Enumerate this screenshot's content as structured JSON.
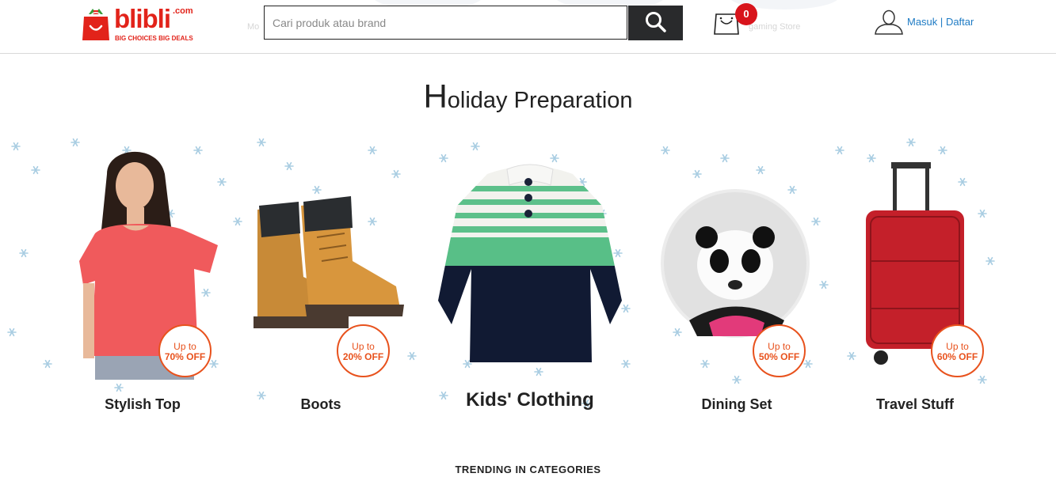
{
  "header": {
    "logo": {
      "word": "blibli",
      "dotcom": ".com",
      "tagline": "BIG CHOICES  BIG DEALS"
    },
    "search": {
      "placeholder": "Cari produk atau brand",
      "value": ""
    },
    "cart": {
      "count": "0"
    },
    "auth": {
      "login": "Masuk",
      "separator": "|",
      "register": "Daftar"
    },
    "ghost": {
      "left": "Mo",
      "right": "gaming Store"
    }
  },
  "promo": {
    "title_cap": "H",
    "title_rest": "oliday Preparation",
    "cards": [
      {
        "label": "Stylish Top",
        "discount_prefix": "Up to",
        "discount": "70% OFF"
      },
      {
        "label": "Boots",
        "discount_prefix": "Up to",
        "discount": "20% OFF"
      },
      {
        "label": "Kids' Clothing"
      },
      {
        "label": "Dining Set",
        "discount_prefix": "Up to",
        "discount": "50% OFF"
      },
      {
        "label": "Travel Stuff",
        "discount_prefix": "Up to",
        "discount": "60% OFF"
      }
    ]
  },
  "trending": {
    "title": "TRENDING IN CATEGORIES"
  },
  "colors": {
    "brand_red": "#e2231a",
    "badge_orange": "#e8521d",
    "link_blue": "#1e7bc4",
    "snow": "#a9cde2"
  }
}
